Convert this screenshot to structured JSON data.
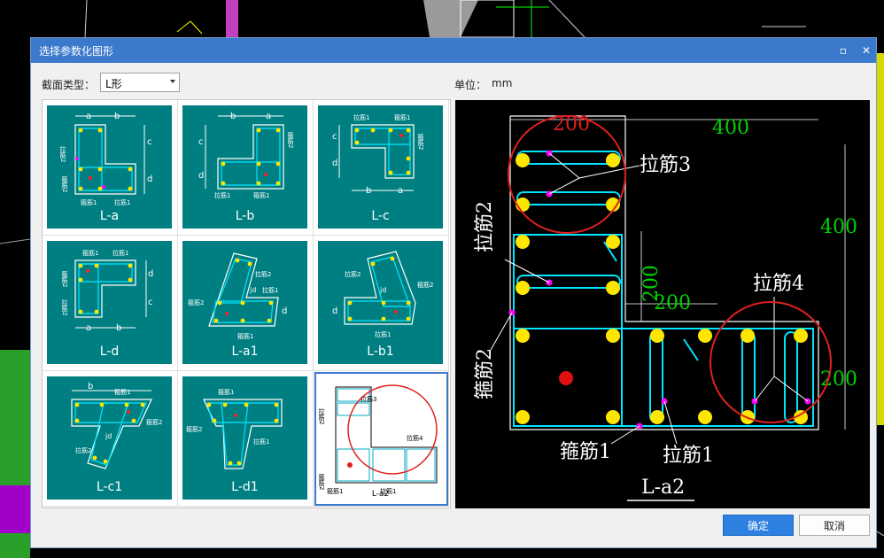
{
  "dialog": {
    "title": "选择参数化图形",
    "maximize_glyph": "▫",
    "close_glyph": "✕"
  },
  "section_type": {
    "label": "截面类型：",
    "value": "L形"
  },
  "unit": {
    "label": "单位：",
    "value": "mm"
  },
  "shapes": [
    {
      "name": "L-a"
    },
    {
      "name": "L-b"
    },
    {
      "name": "L-c"
    },
    {
      "name": "L-d"
    },
    {
      "name": "L-a1"
    },
    {
      "name": "L-b1"
    },
    {
      "name": "L-c1"
    },
    {
      "name": "L-d1"
    },
    {
      "name": "L-a2",
      "selected": true
    }
  ],
  "thumb_labels": {
    "a": "a",
    "b": "b",
    "c": "c",
    "d": "d",
    "jd": "jd",
    "lajin1": "拉筋1",
    "lajin2": "拉筋2",
    "lajin3": "拉筋3",
    "lajin4": "拉筋4",
    "gujin1": "箍筋1",
    "gujin2": "箍筋2"
  },
  "preview": {
    "dims": {
      "top_left": "200",
      "top_right": "400",
      "right_top": "400",
      "mid_vert": "200",
      "mid_horiz": "200",
      "right_bottom": "200"
    },
    "labels": {
      "lajin3": "拉筋3",
      "lajin2": "拉筋2",
      "lajin4": "拉筋4",
      "gujin2": "箍筋2",
      "gujin1": "箍筋1",
      "lajin1": "拉筋1"
    },
    "name": "L-a2"
  },
  "buttons": {
    "ok": "确定",
    "cancel": "取消"
  },
  "colors": {
    "titlebar": "#3b79cc",
    "thumb_bg": "#007f82",
    "rebar": "#00e5ff",
    "bar_dot": "#ffe600",
    "tie_dot": "#ff00ff",
    "highlight": "#e02020",
    "dim_green": "#00d400"
  }
}
